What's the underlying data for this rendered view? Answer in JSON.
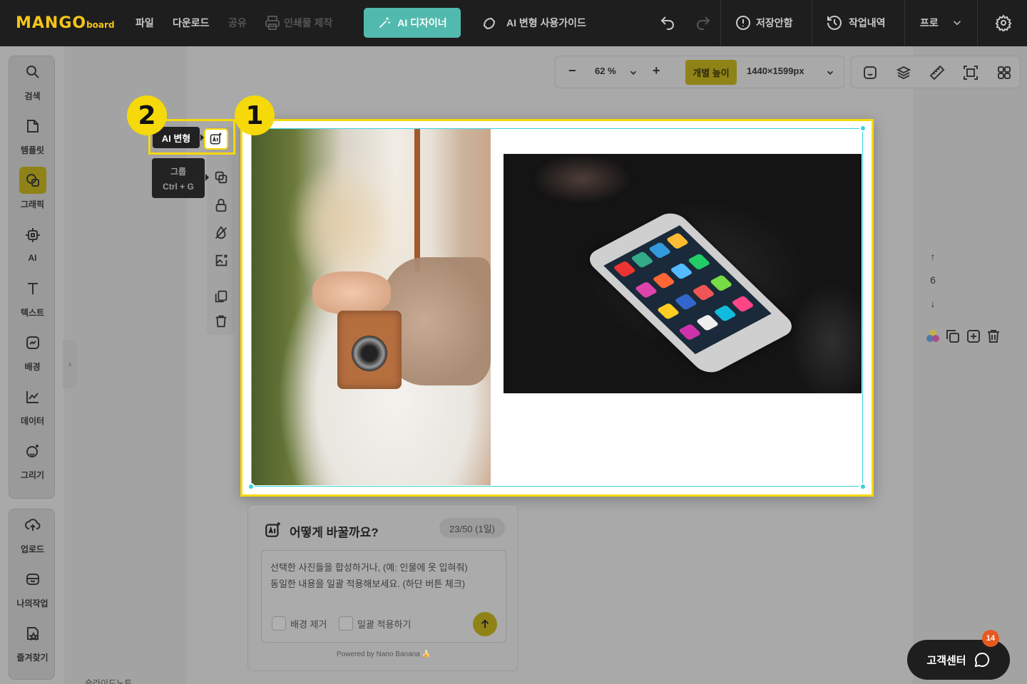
{
  "topbar": {
    "logo_main": "MANGO",
    "logo_sub": "board",
    "menu": [
      "파일",
      "다운로드",
      "공유",
      "인쇄물 제작"
    ],
    "ai_designer": "AI 디자이너",
    "ai_guide": "AI 변형 사용가이드",
    "save_status": "저장안함",
    "history": "작업내역",
    "plan": "프로"
  },
  "sidebar": {
    "items": [
      "검색",
      "템플릿",
      "그래픽",
      "AI",
      "텍스트",
      "배경",
      "데이터",
      "그리기"
    ],
    "items2": [
      "업로드",
      "나의작업",
      "즐겨찾기"
    ]
  },
  "zoom": {
    "value": "62 %",
    "height_mode": "개별 높이",
    "size": "1440×1599px"
  },
  "page_stepper": {
    "current": "6"
  },
  "tooltips": {
    "ai_transform": "AI 변형",
    "group_label": "그룹",
    "group_shortcut": "Ctrl + G"
  },
  "badges": {
    "one": "1",
    "two": "2"
  },
  "ai_panel": {
    "title": "어떻게 바꿀까요?",
    "count": "23/50 (1일)",
    "placeholder_line1": "선택한 사진들을 합성하거나, (예: 인물에 옷 입혀줘)",
    "placeholder_line2": "동일한 내용을 일괄 적용해보세요. (하단 버튼 체크)",
    "remove_bg": "배경 제거",
    "batch_apply": "일괄 적용하기",
    "powered": "Powered by Nano Banana 🍌"
  },
  "slide_note": "슬라이드노트",
  "customer_center": {
    "label": "고객센터",
    "badge": "14"
  },
  "colors": {
    "accent": "#f5d90a",
    "teal": "#52b9ae",
    "selection": "#3ad1d8"
  }
}
